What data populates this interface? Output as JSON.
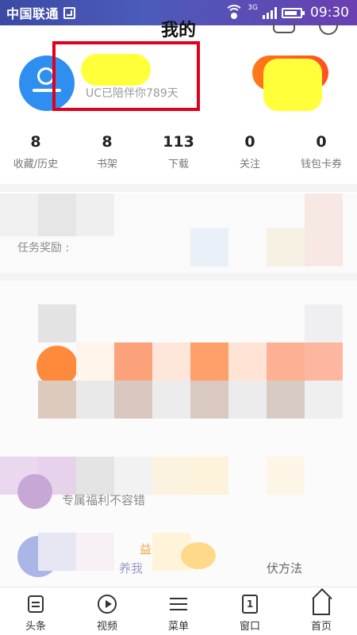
{
  "status_bar": {
    "carrier": "中国联通",
    "network": "3G",
    "time": "09:30"
  },
  "header": {
    "title": "我的"
  },
  "profile": {
    "days_text": "UC已陪伴你789天"
  },
  "stats": [
    {
      "value": "8",
      "label": "收藏/历史"
    },
    {
      "value": "8",
      "label": "书架"
    },
    {
      "value": "113",
      "label": "下载"
    },
    {
      "value": "0",
      "label": "关注"
    },
    {
      "value": "0",
      "label": "钱包卡券"
    }
  ],
  "task_card": {
    "label": "任务奖励 :"
  },
  "blurred_texts": {
    "row1": "专属福利不容错",
    "row2_a": "益",
    "row2_b": "养我",
    "row2_c": "伏方法"
  },
  "bottom_nav": [
    {
      "label": "头条",
      "icon": "news-icon"
    },
    {
      "label": "视频",
      "icon": "video-play-icon"
    },
    {
      "label": "菜单",
      "icon": "menu-icon"
    },
    {
      "label": "窗口",
      "icon": "window-icon",
      "badge": "1"
    },
    {
      "label": "首页",
      "icon": "home-icon"
    }
  ],
  "colors": {
    "accent_blue": "#2f8ff0",
    "highlight_red": "#e0001b",
    "redaction_yellow": "#ffff3a",
    "vip_orange": "#ff7a1a"
  }
}
